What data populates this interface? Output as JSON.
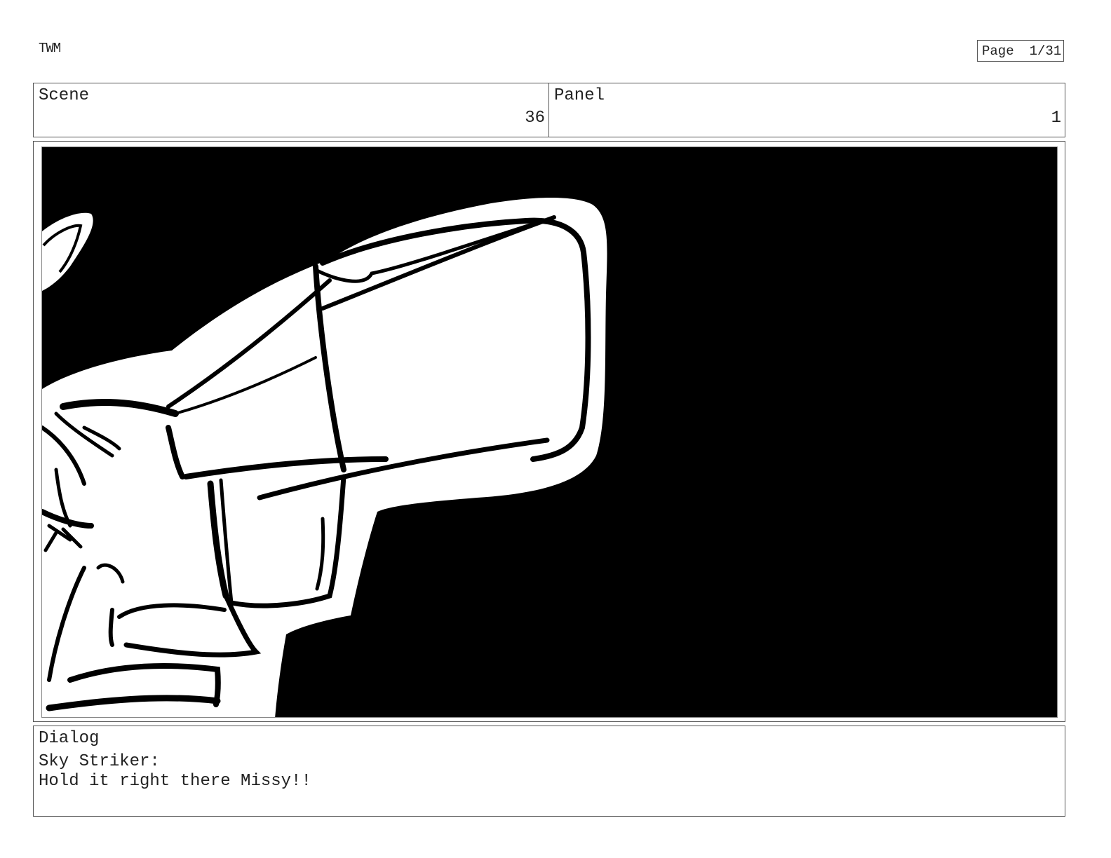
{
  "header": {
    "project": "TWM",
    "page_label": "Page",
    "page_number": "1/31"
  },
  "scene": {
    "label": "Scene",
    "value": "36"
  },
  "panel": {
    "label": "Panel",
    "value": "1"
  },
  "dialog": {
    "label": "Dialog",
    "speaker": "Sky Striker:",
    "text": "Hold it right there Missy!!"
  },
  "colors": {
    "ink": "#000000",
    "paper": "#ffffff",
    "border": "#555555"
  }
}
